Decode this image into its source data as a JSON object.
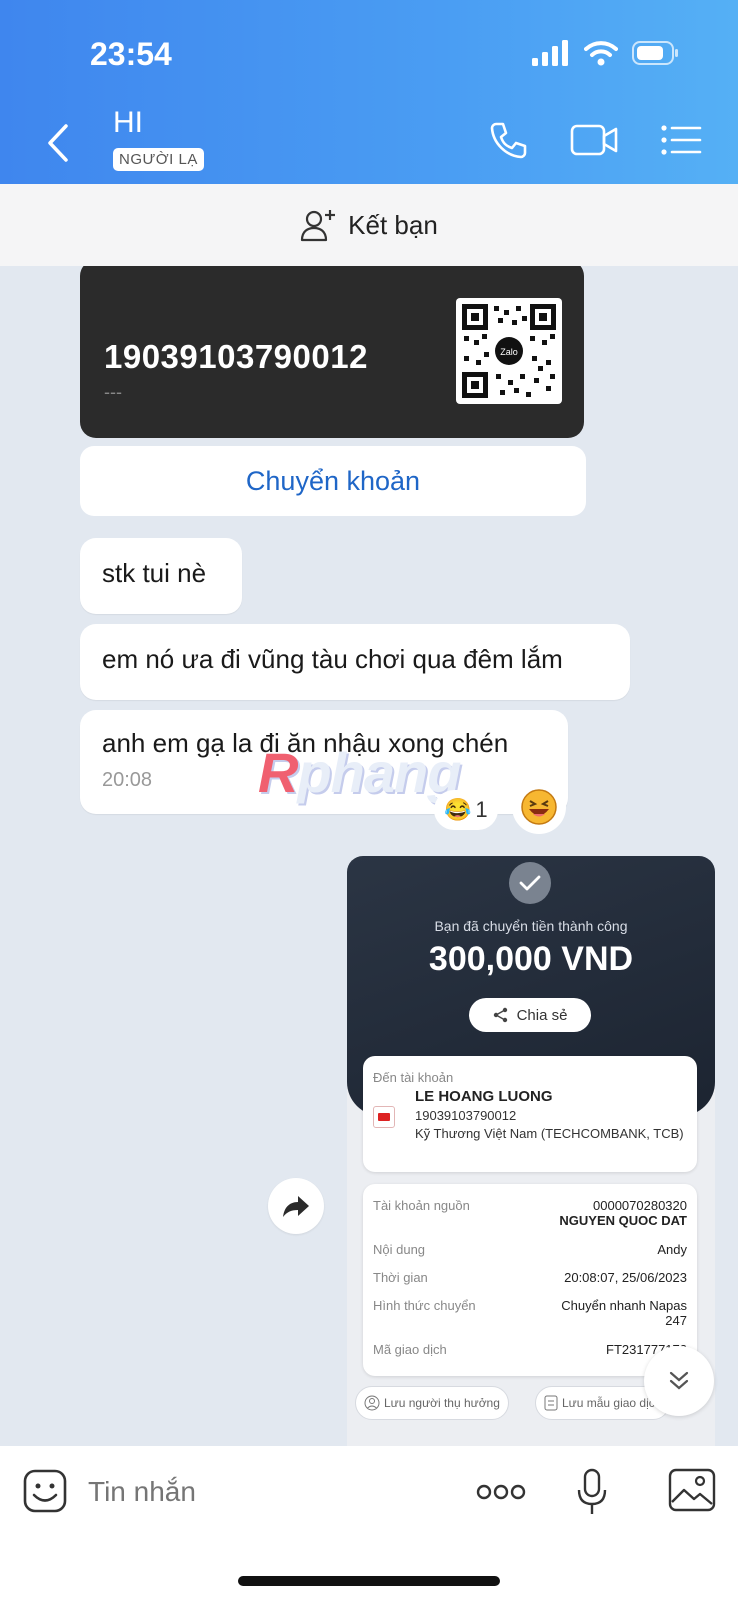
{
  "status_bar": {
    "time": "23:54"
  },
  "header": {
    "name": "HI",
    "badge": "NGƯỜI LẠ",
    "icons": [
      "back-chevron-icon",
      "phone-icon",
      "video-icon",
      "menu-list-icon"
    ]
  },
  "add_friend": {
    "label": "Kết bạn",
    "icon": "add-person-icon"
  },
  "bank_card": {
    "account_number": "19039103790012",
    "sub": "---",
    "qr_label": "Zalo"
  },
  "transfer_button": {
    "label": "Chuyển khoản"
  },
  "messages": [
    {
      "text": "stk tui nè"
    },
    {
      "text": "em nó ưa đi vũng tàu chơi qua đêm lắm"
    },
    {
      "text": "anh em gạ la đi ăn nhậu xong chén",
      "time": "20:08"
    }
  ],
  "reaction": {
    "emoji": "😂",
    "count": "1"
  },
  "watermark": {
    "first": "R",
    "rest": "phang"
  },
  "receipt": {
    "success_text": "Bạn đã chuyển tiền thành công",
    "amount": "300,000 VND",
    "share": "Chia sẻ",
    "to_account_label": "Đến tài khoản",
    "recipient_name": "LE HOANG LUONG",
    "recipient_account": "19039103790012",
    "recipient_bank": "Kỹ Thương Việt Nam (TECHCOMBANK, TCB)",
    "rows": [
      {
        "key": "Tài khoản nguồn",
        "value": "0000070280320",
        "value2": "NGUYEN QUOC DAT"
      },
      {
        "key": "Nội dung",
        "value": "Andy"
      },
      {
        "key": "Thời gian",
        "value": "20:08:07, 25/06/2023"
      },
      {
        "key": "Hình thức chuyển",
        "value": "Chuyển nhanh Napas",
        "value2": "247"
      },
      {
        "key": "Mã giao dịch",
        "value": "FT231777172"
      }
    ],
    "save_beneficiary": "Lưu người thụ hưởng",
    "save_template": "Lưu mẫu giao dịch"
  },
  "composer": {
    "placeholder": "Tin nhắn"
  },
  "colors": {
    "header_blue": "#3f86ee",
    "link_blue": "#1f66c7"
  }
}
